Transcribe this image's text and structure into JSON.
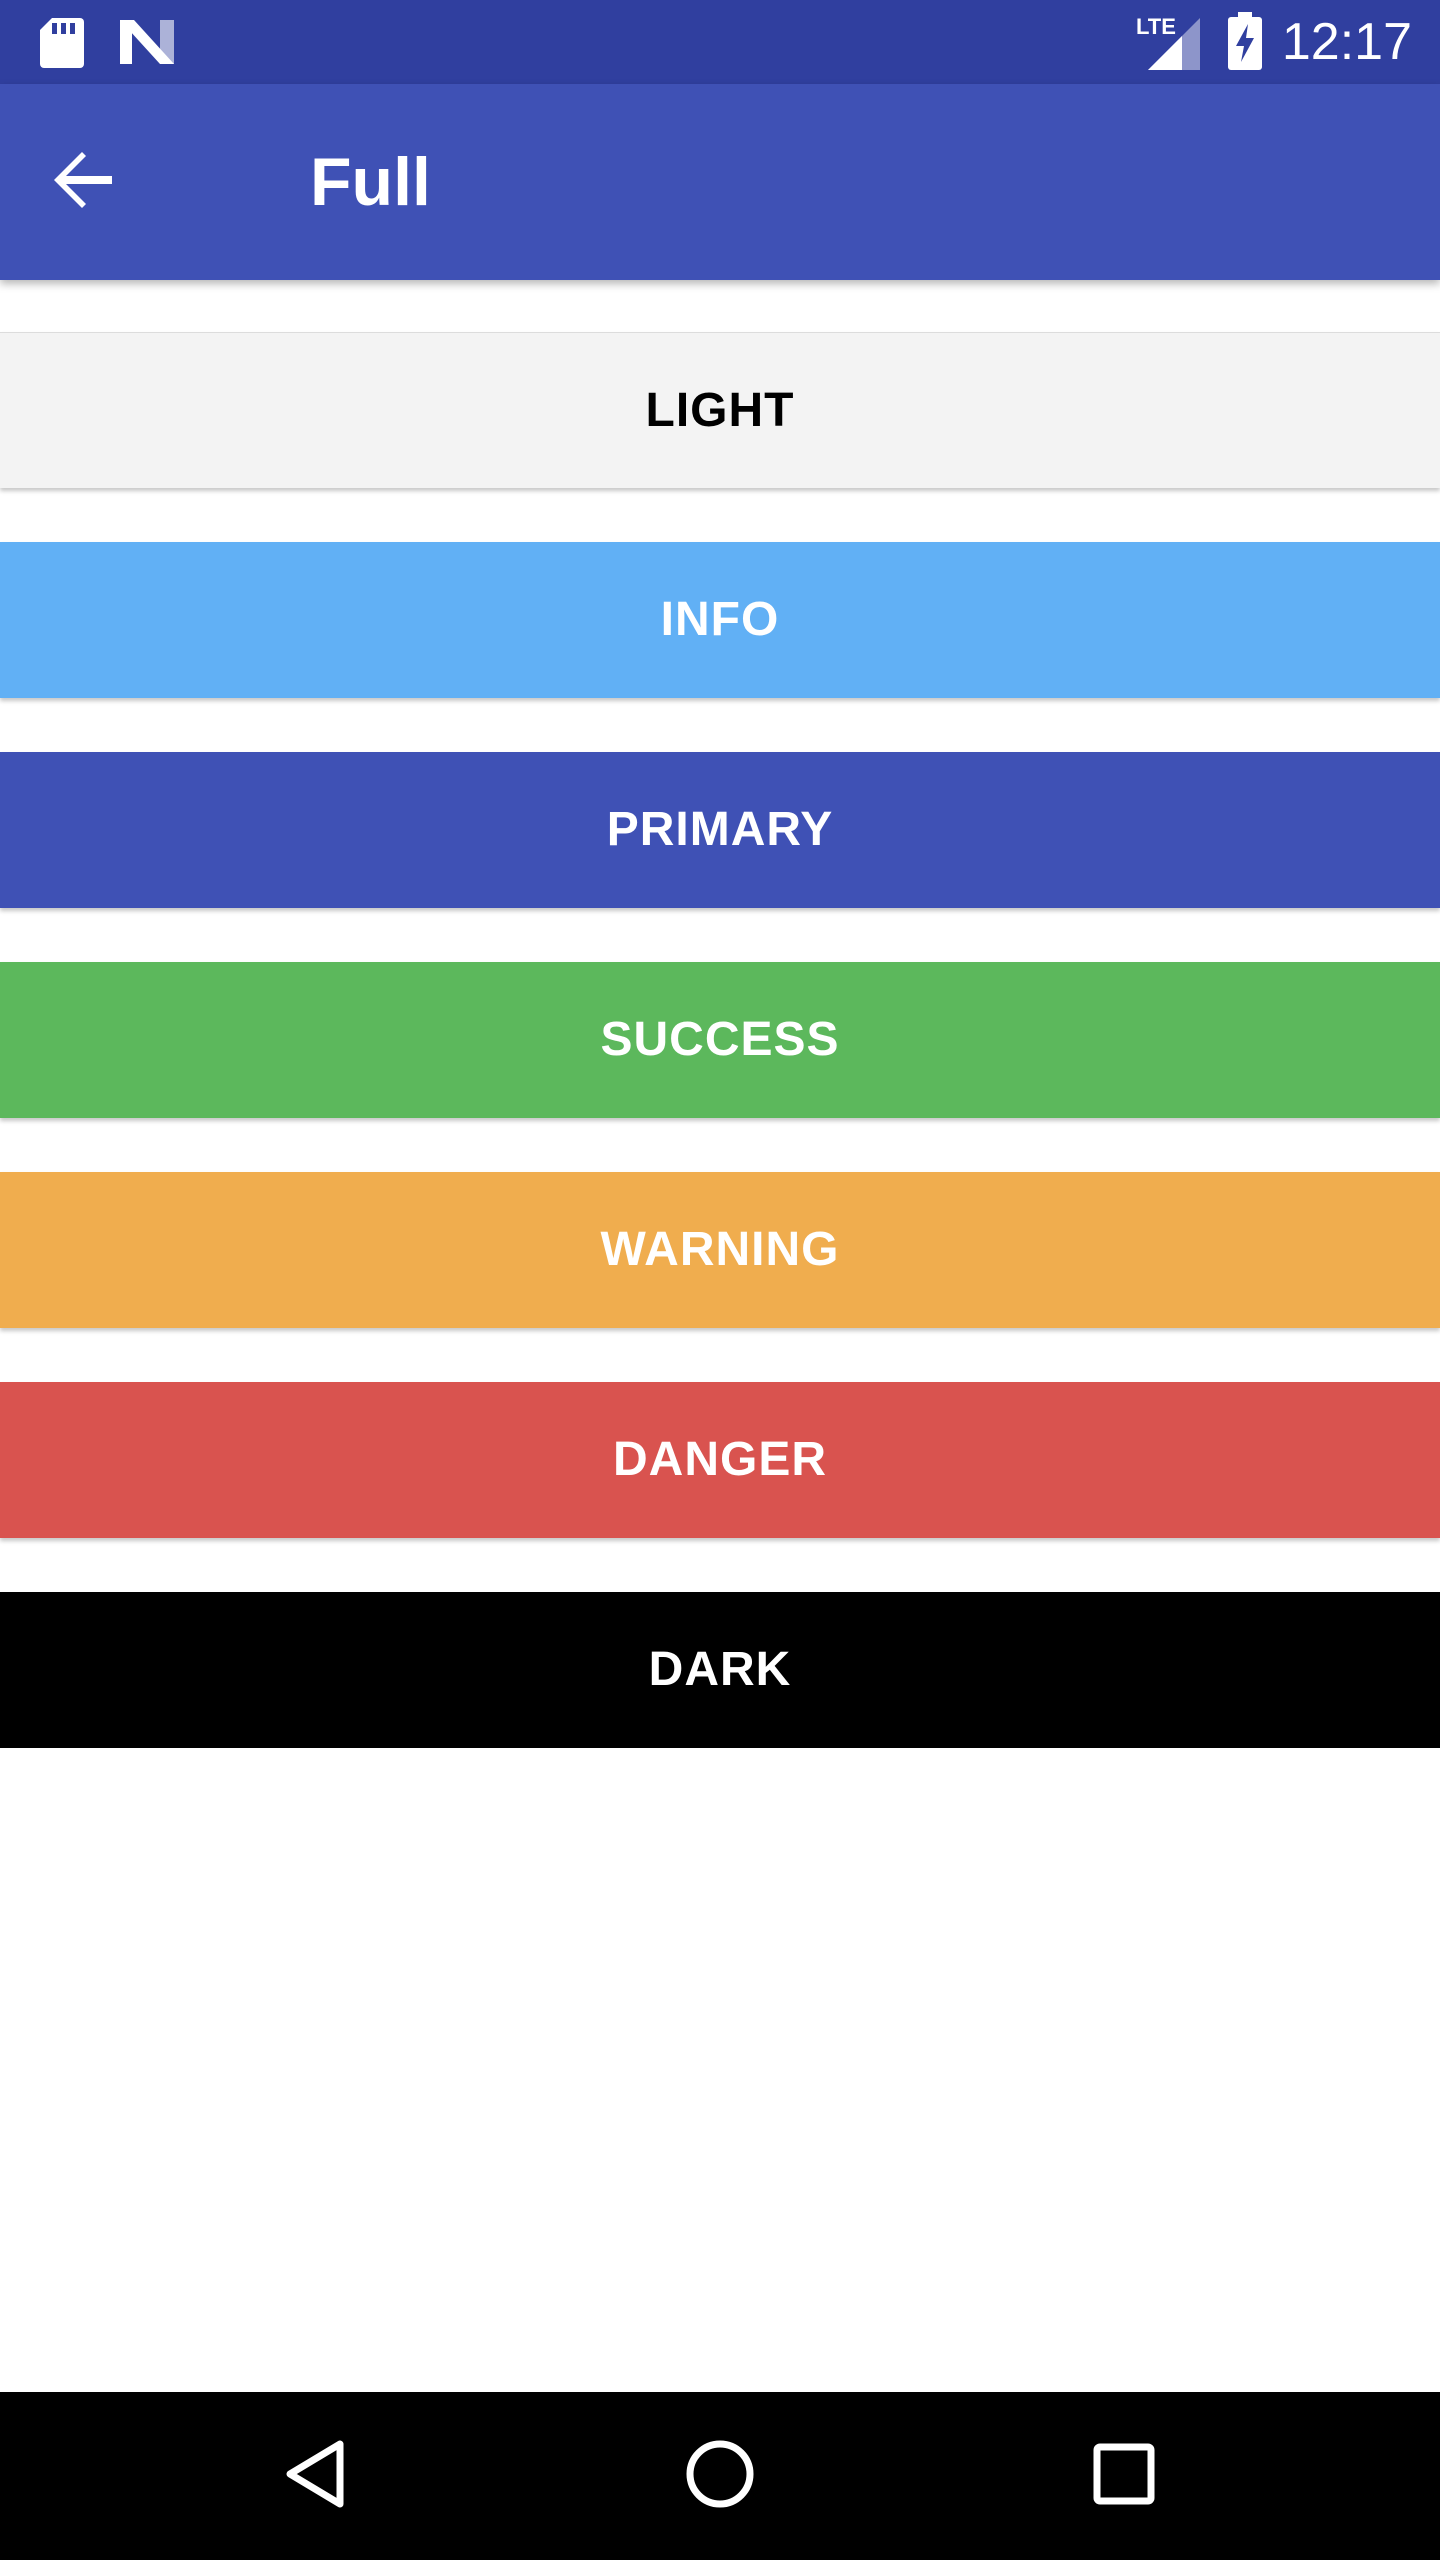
{
  "status_bar": {
    "time": "12:17",
    "network_label": "LTE",
    "background_color": "#303F9F",
    "icons": [
      "sd-card-icon",
      "n-logo-icon",
      "lte-signal-icon",
      "battery-charging-icon"
    ]
  },
  "app_bar": {
    "title": "Full",
    "back_icon": "arrow-back-icon",
    "background_color": "#3F51B5"
  },
  "buttons": [
    {
      "id": "light",
      "label": "LIGHT",
      "bg": "#F3F3F3",
      "fg": "#000000"
    },
    {
      "id": "info",
      "label": "INFO",
      "bg": "#61B0F5",
      "fg": "#FFFFFF"
    },
    {
      "id": "primary",
      "label": "PRIMARY",
      "bg": "#3F51B5",
      "fg": "#FFFFFF"
    },
    {
      "id": "success",
      "label": "SUCCESS",
      "bg": "#5CB85C",
      "fg": "#FFFFFF"
    },
    {
      "id": "warning",
      "label": "WARNING",
      "bg": "#F0AD4E",
      "fg": "#FFFFFF"
    },
    {
      "id": "danger",
      "label": "DANGER",
      "bg": "#D9534F",
      "fg": "#FFFFFF"
    },
    {
      "id": "dark",
      "label": "DARK",
      "bg": "#000000",
      "fg": "#FFFFFF"
    }
  ],
  "nav_bar": {
    "icons": [
      "back-triangle-icon",
      "home-circle-icon",
      "recents-square-icon"
    ]
  }
}
